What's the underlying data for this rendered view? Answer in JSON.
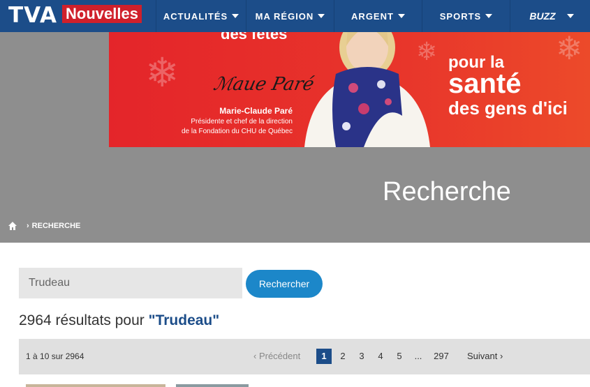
{
  "nav": {
    "logo_tva": "TVA",
    "logo_nouvelles": "Nouvelles",
    "items": [
      {
        "label": "ACTUALITÉS"
      },
      {
        "label": "MA RÉGION"
      },
      {
        "label": "ARGENT"
      },
      {
        "label": "SPORTS"
      },
      {
        "label": "BUZZ"
      }
    ],
    "color": "#1c4d89"
  },
  "banner": {
    "top_left": "des fêtes",
    "line2": "pour la",
    "line3": "santé",
    "line4": "des gens d'ici",
    "signature_name": "Marie-Claude Paré",
    "signature_title": "Présidente et chef de la direction",
    "signature_org": "de la Fondation du CHU de Québec",
    "color": "#e4252a"
  },
  "page": {
    "title": "Recherche",
    "breadcrumb": "RECHERCHE"
  },
  "search": {
    "value": "Trudeau",
    "button_label": "Rechercher"
  },
  "results": {
    "count_text": "2964 résultats pour ",
    "query_text": "\"Trudeau\""
  },
  "pagination": {
    "range_text": "1 à 10 sur 2964",
    "prev_label": "Précédent",
    "next_label": "Suivant",
    "pages": [
      "1",
      "2",
      "3",
      "4",
      "5",
      "...",
      "297"
    ],
    "current": "1"
  }
}
